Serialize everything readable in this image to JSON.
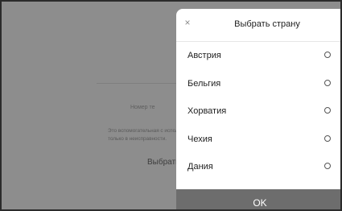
{
  "background": {
    "phone_label": "Номер те",
    "helper_text": "Это вспомогательная с используется только в неисправности.",
    "select_label": "Выбрать"
  },
  "sheet": {
    "title": "Выбрать страну",
    "close_glyph": "×",
    "countries": [
      {
        "label": "Австрия",
        "selected": false
      },
      {
        "label": "Бельгия",
        "selected": false
      },
      {
        "label": "Хорватия",
        "selected": false
      },
      {
        "label": "Чехия",
        "selected": false
      },
      {
        "label": "Дания",
        "selected": false
      }
    ],
    "ok_label": "OK"
  }
}
